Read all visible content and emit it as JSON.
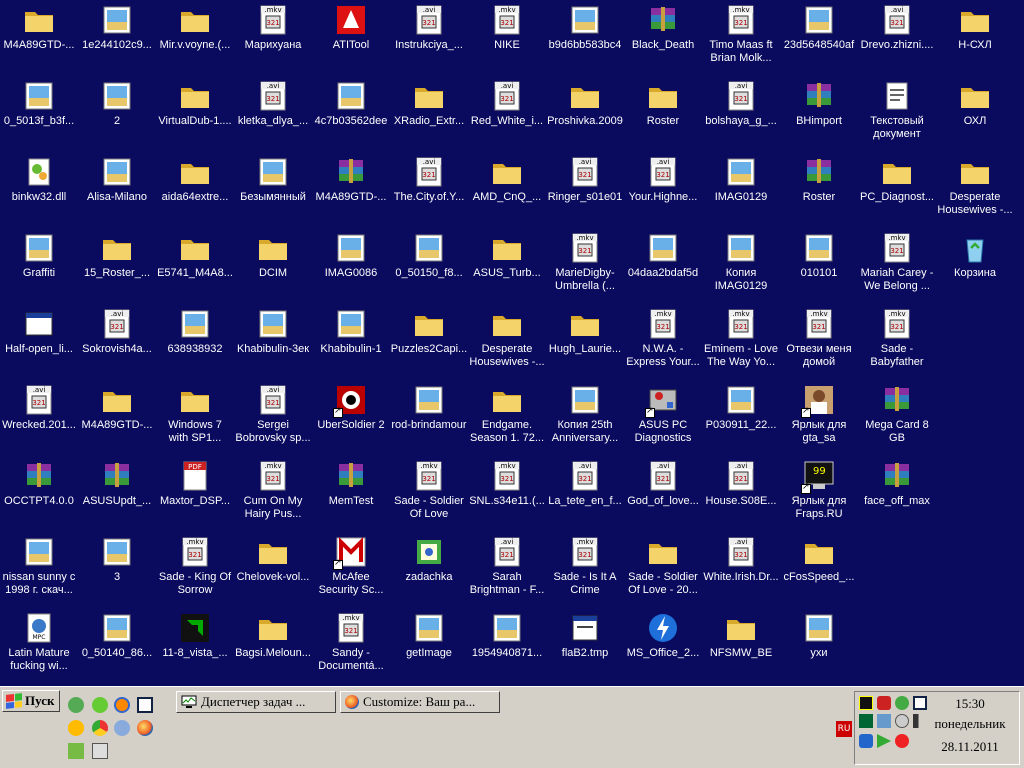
{
  "desktop": {
    "icons": [
      {
        "label": "M4A89GTD-...",
        "type": "folder"
      },
      {
        "label": "0_5013f_b3f...",
        "type": "image"
      },
      {
        "label": "binkw32.dll",
        "type": "dll"
      },
      {
        "label": "Graffiti",
        "type": "image"
      },
      {
        "label": "Half-open_li...",
        "type": "window"
      },
      {
        "label": "Wrecked.201...",
        "type": "avi"
      },
      {
        "label": "OCCTPT4.0.0",
        "type": "rar"
      },
      {
        "label": "nissan sunny c\n1998 г. скач...",
        "type": "image"
      },
      {
        "label": "Latin Mature\nfucking wi...",
        "type": "mpc"
      },
      {
        "label": "1e244102c9...",
        "type": "image"
      },
      {
        "label": "2",
        "type": "image"
      },
      {
        "label": "Alisa-Milano",
        "type": "image"
      },
      {
        "label": "15_Roster_...",
        "type": "folder"
      },
      {
        "label": "Sokrovish4a...",
        "type": "avi"
      },
      {
        "label": "M4A89GTD-...",
        "type": "folder"
      },
      {
        "label": "ASUSUpdt_...",
        "type": "rar"
      },
      {
        "label": "3",
        "type": "image"
      },
      {
        "label": "0_50140_86...",
        "type": "image"
      },
      {
        "label": "Mir.v.voyne.(...",
        "type": "folder"
      },
      {
        "label": "VirtualDub-1....",
        "type": "folder"
      },
      {
        "label": "aida64extre...",
        "type": "folder"
      },
      {
        "label": "E5741_M4A8...",
        "type": "folder"
      },
      {
        "label": "638938932",
        "type": "image"
      },
      {
        "label": "Windows 7\nwith SP1...",
        "type": "folder"
      },
      {
        "label": "Maxtor_DSP...",
        "type": "pdf"
      },
      {
        "label": "Sade - King Of\nSorrow",
        "type": "mkv"
      },
      {
        "label": "11-8_vista_...",
        "type": "amd"
      },
      {
        "label": "Марихуана",
        "type": "mkv"
      },
      {
        "label": "kletka_dlya_...",
        "type": "avi"
      },
      {
        "label": "Безымянный",
        "type": "image"
      },
      {
        "label": "DCIM",
        "type": "folder"
      },
      {
        "label": "Khabibulin-3ек",
        "type": "image"
      },
      {
        "label": "Sergei\nBobrovsky sp...",
        "type": "avi"
      },
      {
        "label": "Cum On My\nHairy Pus...",
        "type": "mkv"
      },
      {
        "label": "Chelovek-vol...",
        "type": "folder"
      },
      {
        "label": "Bagsi.Meloun...",
        "type": "folder"
      },
      {
        "label": "ATITool",
        "type": "atitool"
      },
      {
        "label": "4c7b03562dee",
        "type": "image"
      },
      {
        "label": "M4A89GTD-...",
        "type": "rar"
      },
      {
        "label": "IMAG0086",
        "type": "image"
      },
      {
        "label": "Khabibulin-1",
        "type": "image"
      },
      {
        "label": "UberSoldier 2",
        "type": "ubersoldier",
        "shortcut": true
      },
      {
        "label": "MemTest",
        "type": "rar"
      },
      {
        "label": "McAfee\nSecurity Sc...",
        "type": "mcafee",
        "shortcut": true
      },
      {
        "label": "Sandy -\nDocumentá...",
        "type": "mkv"
      },
      {
        "label": "Instrukciya_...",
        "type": "avi"
      },
      {
        "label": "XRadio_Extr...",
        "type": "folder"
      },
      {
        "label": "The.City.of.Y...",
        "type": "avi"
      },
      {
        "label": "0_50150_f8...",
        "type": "image"
      },
      {
        "label": "Puzzles2Capi...",
        "type": "folder"
      },
      {
        "label": "rod-brindamour",
        "type": "image"
      },
      {
        "label": "Sade - Soldier\nOf Love",
        "type": "mkv"
      },
      {
        "label": "zadachka",
        "type": "zadachka"
      },
      {
        "label": "getImage",
        "type": "image"
      },
      {
        "label": "NIKE",
        "type": "mkv"
      },
      {
        "label": "Red_White_i...",
        "type": "avi"
      },
      {
        "label": "AMD_CnQ_...",
        "type": "folder"
      },
      {
        "label": "ASUS_Turb...",
        "type": "folder"
      },
      {
        "label": "Desperate\nHousewives -...",
        "type": "folder"
      },
      {
        "label": "Endgame.\nSeason 1. 72...",
        "type": "folder"
      },
      {
        "label": "SNL.s34e11.(...",
        "type": "mkv"
      },
      {
        "label": "Sarah\nBrightman - F...",
        "type": "avi"
      },
      {
        "label": "1954940871...",
        "type": "image"
      },
      {
        "label": "b9d6bb583bc4",
        "type": "image"
      },
      {
        "label": "Proshivka.2009",
        "type": "folder"
      },
      {
        "label": "Ringer_s01e01",
        "type": "avi"
      },
      {
        "label": "MarieDigby-\nUmbrella (...",
        "type": "mkv"
      },
      {
        "label": "Hugh_Laurie...",
        "type": "folder"
      },
      {
        "label": "Копия 25th\nAnniversary...",
        "type": "image"
      },
      {
        "label": "La_tete_en_f...",
        "type": "avi"
      },
      {
        "label": "Sade - Is It A\nCrime",
        "type": "mkv"
      },
      {
        "label": "flaB2.tmp",
        "type": "tmp"
      },
      {
        "label": "Black_Death",
        "type": "rar"
      },
      {
        "label": "Roster",
        "type": "folder"
      },
      {
        "label": "Your.Highne...",
        "type": "avi"
      },
      {
        "label": "04daa2bdaf5d",
        "type": "image"
      },
      {
        "label": "N.W.A. -\nExpress Your...",
        "type": "mkv"
      },
      {
        "label": "ASUS PC\nDiagnostics",
        "type": "asusdiag",
        "shortcut": true
      },
      {
        "label": "God_of_love...",
        "type": "avi"
      },
      {
        "label": "Sade - Soldier\nOf Love - 20...",
        "type": "folder"
      },
      {
        "label": "MS_Office_2...",
        "type": "msoffice"
      },
      {
        "label": "Timo Maas ft\nBrian Molk...",
        "type": "mkv"
      },
      {
        "label": "bolshaya_g_...",
        "type": "avi"
      },
      {
        "label": "IMAG0129",
        "type": "image"
      },
      {
        "label": "Копия\nIMAG0129",
        "type": "image"
      },
      {
        "label": "Eminem - Love\nThe Way Yo...",
        "type": "mkv"
      },
      {
        "label": "P030911_22...",
        "type": "image"
      },
      {
        "label": "House.S08E...",
        "type": "avi"
      },
      {
        "label": "White.Irish.Dr...",
        "type": "avi"
      },
      {
        "label": "NFSMW_BE",
        "type": "folder"
      },
      {
        "label": "23d5648540af",
        "type": "image"
      },
      {
        "label": "BHimport",
        "type": "rar"
      },
      {
        "label": "Roster",
        "type": "rar"
      },
      {
        "label": "010101",
        "type": "image"
      },
      {
        "label": "Отвези меня\nдомой",
        "type": "mkv"
      },
      {
        "label": "Ярлык для\ngta_sa",
        "type": "gta",
        "shortcut": true
      },
      {
        "label": "Ярлык для\nFraps.RU",
        "type": "fraps",
        "shortcut": true
      },
      {
        "label": "cFosSpeed_...",
        "type": "folder"
      },
      {
        "label": "ухи",
        "type": "image"
      },
      {
        "label": "Drevo.zhizni....",
        "type": "avi"
      },
      {
        "label": "Текстовый\nдокумент",
        "type": "text"
      },
      {
        "label": "PC_Diagnost...",
        "type": "folder"
      },
      {
        "label": "Mariah Carey -\nWe Belong ...",
        "type": "mkv"
      },
      {
        "label": "Sade -\nBabyfather",
        "type": "mkv"
      },
      {
        "label": "Mega Card 8\nGB",
        "type": "rar"
      },
      {
        "label": "face_off_max",
        "type": "rar"
      },
      {
        "label": "H-СХЛ",
        "type": "folder"
      },
      {
        "label": "ОХЛ",
        "type": "folder"
      },
      {
        "label": "Desperate\nHousewives -...",
        "type": "folder"
      },
      {
        "label": "Корзина",
        "type": "recycle"
      }
    ]
  },
  "taskbar": {
    "start_label": "Пуск",
    "tasks": [
      {
        "label": "Диспетчер задач ..."
      },
      {
        "label": "Customize: Ваш ра..."
      }
    ],
    "language": "RU",
    "clock": {
      "time": "15:30",
      "weekday": "понедельник",
      "date": "28.11.2011"
    }
  },
  "colors": {
    "desktop_bg": "#0a0a5e",
    "taskbar_bg": "#d4d0c8",
    "label_text": "#ffffff",
    "folder": "#f5d36b",
    "folder_shade": "#d9a92c"
  }
}
